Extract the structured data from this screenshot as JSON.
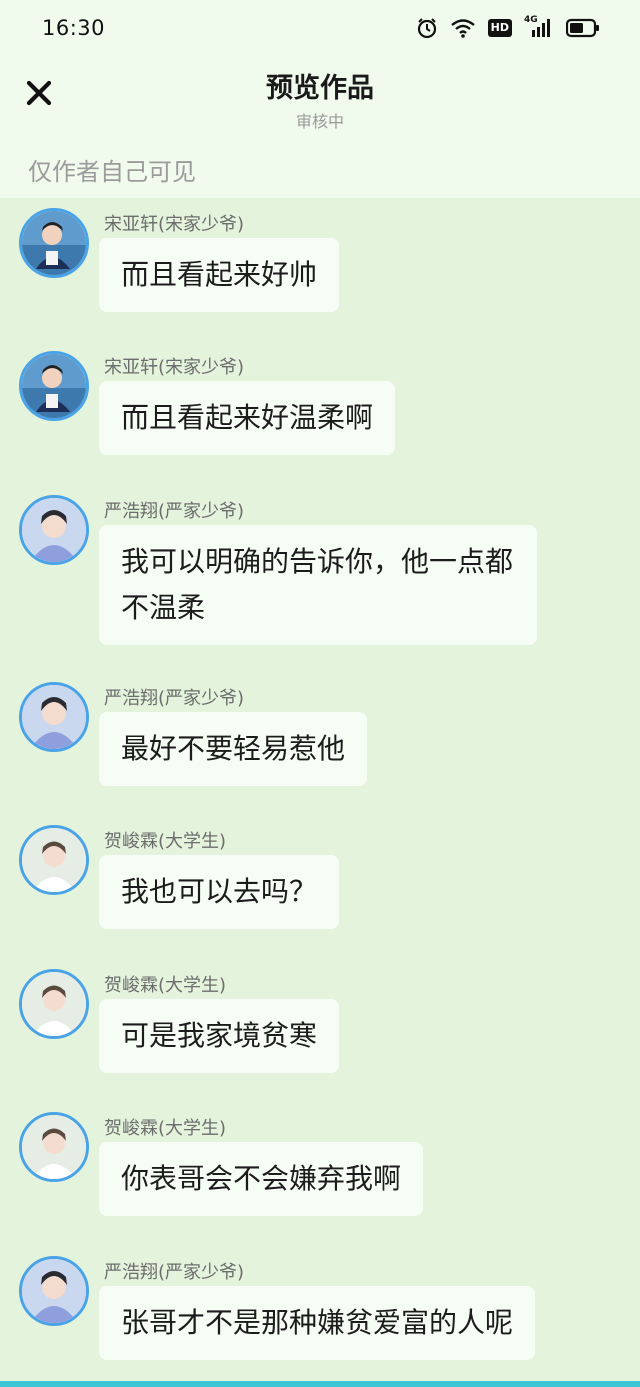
{
  "status_bar": {
    "time": "16:30",
    "icons": [
      "alarm-icon",
      "wifi-icon",
      "hd-icon",
      "4g-signal-icon",
      "battery-icon"
    ],
    "hd_label": "HD",
    "network_label": "4G"
  },
  "header": {
    "title": "预览作品",
    "subtitle": "审核中",
    "close_icon": "close-icon"
  },
  "notice": "仅作者自己可见",
  "colors": {
    "background": "#e3f3dc",
    "header_background": "#f0fbee",
    "bubble": "#f6fdf4",
    "avatar_ring": "#4aa3e6",
    "bottom_accent": "#3cc6d6"
  },
  "messages": [
    {
      "sender": "宋亚轩(宋家少爷)",
      "text": "而且看起来好帅"
    },
    {
      "sender": "宋亚轩(宋家少爷)",
      "text": "而且看起来好温柔啊"
    },
    {
      "sender": "严浩翔(严家少爷)",
      "text": "我可以明确的告诉你，他一点都不温柔"
    },
    {
      "sender": "严浩翔(严家少爷)",
      "text": "最好不要轻易惹他"
    },
    {
      "sender": "贺峻霖(大学生)",
      "text": "我也可以去吗？"
    },
    {
      "sender": "贺峻霖(大学生)",
      "text": "可是我家境贫寒"
    },
    {
      "sender": "贺峻霖(大学生)",
      "text": "你表哥会不会嫌弃我啊"
    },
    {
      "sender": "严浩翔(严家少爷)",
      "text": "张哥才不是那种嫌贫爱富的人呢"
    }
  ]
}
